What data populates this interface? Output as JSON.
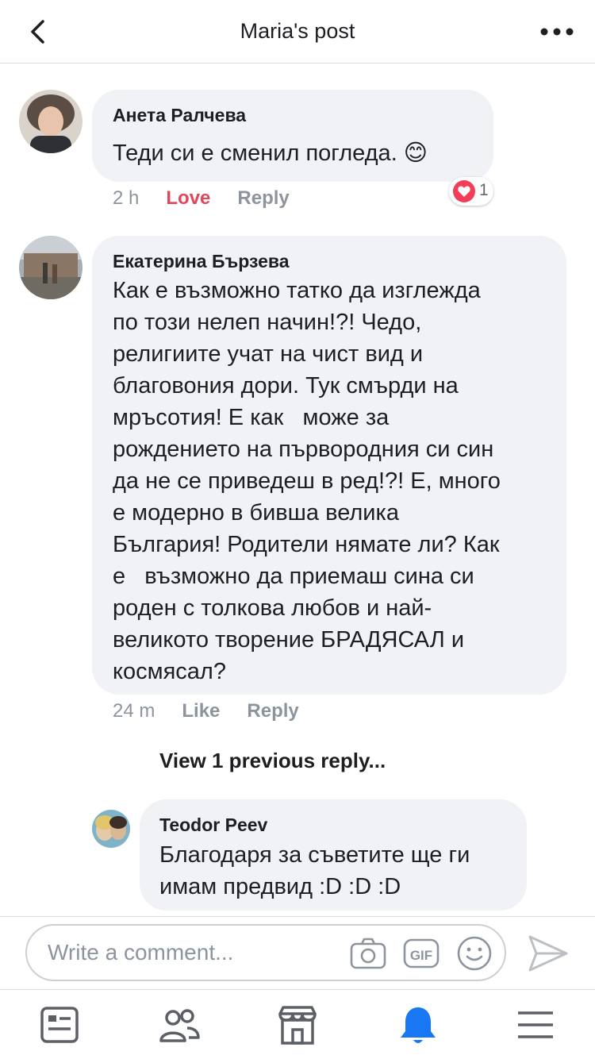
{
  "header": {
    "title": "Maria's post"
  },
  "comments": [
    {
      "author": "Анета Ралчева",
      "text": "Теди си е сменил погледа. 😊",
      "time": "2 h",
      "reaction_label": "Love",
      "reply_label": "Reply",
      "reaction_count": "1"
    },
    {
      "author": "Екатерина Бързева",
      "lines": [
        "Как е възможно татко да изглежда",
        "по този нелеп начин!?! Чедо,",
        "религиите учат на чист вид и",
        "благовония дори. Тук смърди на",
        "мръсотия! Е как   може за",
        "рождението на първородния си син",
        "да не се приведеш в ред!?! Е, много",
        "е модерно в бивша велика",
        "България! Родители нямате ли? Как",
        "е   възможно да приемаш сина си",
        "роден с толкова любов и най-",
        "великото творение БРАДЯСАЛ и",
        "космясал?"
      ],
      "time": "24 m",
      "like_label": "Like",
      "reply_label": "Reply"
    }
  ],
  "view_previous": "View 1 previous reply...",
  "reply": {
    "author": "Teodor Peev",
    "lines": [
      "Благодаря за съветите ще ги",
      "имам предвид :D :D :D"
    ]
  },
  "composer": {
    "placeholder": "Write a comment...",
    "icons": [
      "camera-icon",
      "gif-icon",
      "emoji-icon",
      "send-icon"
    ]
  },
  "tabs": [
    "news-feed-icon",
    "friends-icon",
    "marketplace-icon",
    "notifications-icon",
    "menu-icon"
  ],
  "colors": {
    "accent": "#1877f2",
    "love": "#e0475a",
    "bubble": "#f0f2f5",
    "muted": "#8d949e"
  }
}
